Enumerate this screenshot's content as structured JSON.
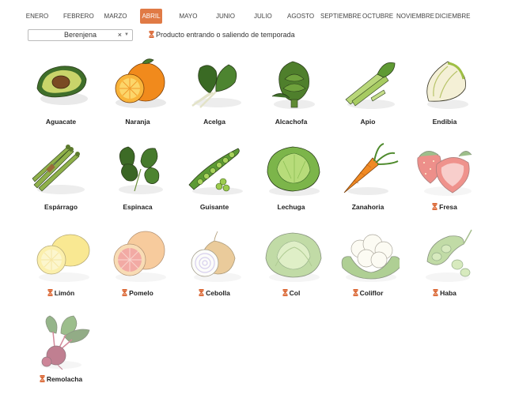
{
  "months": [
    {
      "label": "ENERO",
      "active": false
    },
    {
      "label": "FEBRERO",
      "active": false
    },
    {
      "label": "MARZO",
      "active": false
    },
    {
      "label": "ABRIL",
      "active": true
    },
    {
      "label": "MAYO",
      "active": false
    },
    {
      "label": "JUNIO",
      "active": false
    },
    {
      "label": "JULIO",
      "active": false
    },
    {
      "label": "AGOSTO",
      "active": false
    },
    {
      "label": "SEPTIEMBRE",
      "active": false
    },
    {
      "label": "OCTUBRE",
      "active": false
    },
    {
      "label": "NOVIEMBRE",
      "active": false
    },
    {
      "label": "DICIEMBRE",
      "active": false
    }
  ],
  "filter": {
    "selected": "Berenjena",
    "clear_icon": "×",
    "caret_icon": "▼",
    "legend_icon": "hourglass-icon",
    "legend_text": "Producto entrando o saliendo de temporada"
  },
  "colors": {
    "accent": "#e07a45",
    "hourglass": "#d9602b"
  },
  "products": [
    {
      "name": "Aguacate",
      "seasonal_transition": false,
      "icon": "avocado-icon"
    },
    {
      "name": "Naranja",
      "seasonal_transition": false,
      "icon": "orange-icon"
    },
    {
      "name": "Acelga",
      "seasonal_transition": false,
      "icon": "chard-icon"
    },
    {
      "name": "Alcachofa",
      "seasonal_transition": false,
      "icon": "artichoke-icon"
    },
    {
      "name": "Apio",
      "seasonal_transition": false,
      "icon": "celery-icon"
    },
    {
      "name": "Endibia",
      "seasonal_transition": false,
      "icon": "endive-icon"
    },
    {
      "name": "Espárrago",
      "seasonal_transition": false,
      "icon": "asparagus-icon"
    },
    {
      "name": "Espinaca",
      "seasonal_transition": false,
      "icon": "spinach-icon"
    },
    {
      "name": "Guisante",
      "seasonal_transition": false,
      "icon": "pea-icon"
    },
    {
      "name": "Lechuga",
      "seasonal_transition": false,
      "icon": "lettuce-icon"
    },
    {
      "name": "Zanahoria",
      "seasonal_transition": false,
      "icon": "carrot-icon"
    },
    {
      "name": "Fresa",
      "seasonal_transition": true,
      "icon": "strawberry-icon"
    },
    {
      "name": "Limón",
      "seasonal_transition": true,
      "icon": "lemon-icon"
    },
    {
      "name": "Pomelo",
      "seasonal_transition": true,
      "icon": "grapefruit-icon"
    },
    {
      "name": "Cebolla",
      "seasonal_transition": true,
      "icon": "onion-icon"
    },
    {
      "name": "Col",
      "seasonal_transition": true,
      "icon": "cabbage-icon"
    },
    {
      "name": "Coliflor",
      "seasonal_transition": true,
      "icon": "cauliflower-icon"
    },
    {
      "name": "Haba",
      "seasonal_transition": true,
      "icon": "broad-bean-icon"
    },
    {
      "name": "Remolacha",
      "seasonal_transition": true,
      "icon": "beet-icon"
    }
  ]
}
